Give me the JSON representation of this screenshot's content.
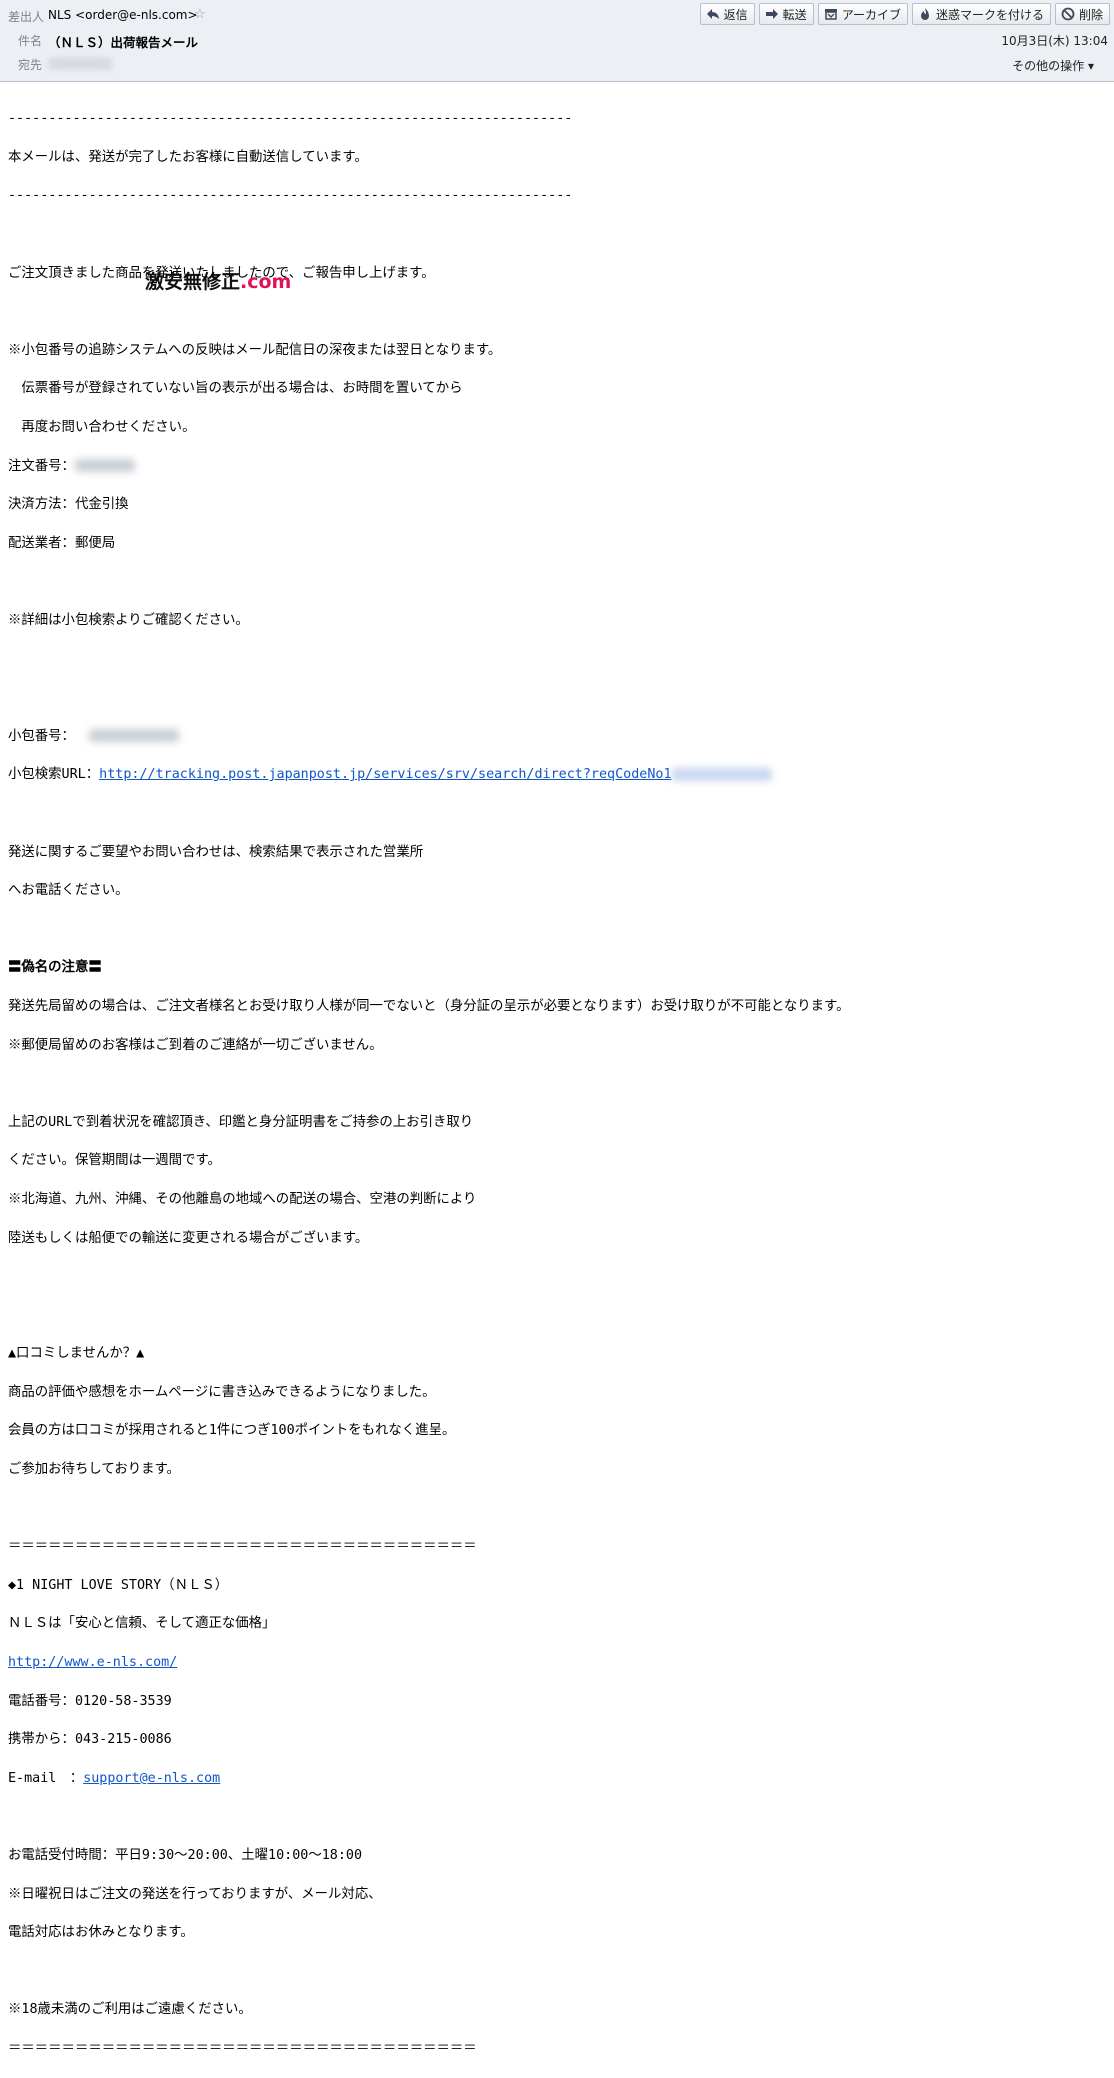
{
  "header": {
    "from_label": "差出人",
    "from_value": "NLS <order@e-nls.com>",
    "subject_label": "件名",
    "subject_value": "（ＮＬＳ）出荷報告メール",
    "to_label": "宛先",
    "date": "10月3日(木) 13:04",
    "more_actions": "その他の操作 ▾",
    "toolbar": {
      "reply": "返信",
      "forward": "転送",
      "archive": "アーカイブ",
      "junk": "迷惑マークを付ける",
      "delete": "削除"
    }
  },
  "watermark": {
    "main": "激安無修正",
    "suffix": ".com"
  },
  "body": {
    "rule_dash": "----------------------------------------------------------------------",
    "notice": "本メールは、発送が完了したお客様に自動送信しています。",
    "intro": "ご注文頂きました商品を発送いたしましたので、ご報告申し上げます。",
    "note1": "※小包番号の追跡システムへの反映はメール配信日の深夜または翌日となります。",
    "note2": "　伝票番号が登録されていない旨の表示が出る場合は、お時間を置いてから",
    "note3": "　再度お問い合わせください。",
    "order_no_label": "注文番号：",
    "payment": "決済方法：代金引換",
    "carrier": "配送業者：郵便局",
    "detail_note": "※詳細は小包検索よりご確認ください。",
    "parcel_no_label": "小包番号：",
    "tracking_label": "小包検索URL：",
    "tracking_url": "http://tracking.post.japanpost.jp/services/srv/search/direct?reqCodeNo1",
    "contact1": "発送に関するご要望やお問い合わせは、検索結果で表示された営業所",
    "contact2": "へお電話ください。",
    "alias_heading": "〓偽名の注意〓",
    "alias1": "発送先局留めの場合は、ご注文者様名とお受け取り人様が同一でないと（身分証の呈示が必要となります）お受け取りが不可能となります。",
    "alias2": "※郵便局留めのお客様はご到着のご連絡が一切ございません。",
    "pickup1": "上記のURLで到着状況を確認頂き、印鑑と身分証明書をご持参の上お引き取り",
    "pickup2": "ください。保管期間は一週間です。",
    "pickup3": "※北海道、九州、沖縄、その他離島の地域への配送の場合、空港の判断により",
    "pickup4": "陸送もしくは船便での輸送に変更される場合がございます。",
    "review_heading": "▲口コミしませんか？▲",
    "review1": "商品の評価や感想をホームページに書き込みできるようになりました。",
    "review2": "会員の方は口コミが採用されると1件につぎ100ポイントをもれなく進呈。",
    "review3": "ご参加お待ちしております。",
    "rule_eq": "＝＝＝＝＝＝＝＝＝＝＝＝＝＝＝＝＝＝＝＝＝＝＝＝＝＝＝＝＝＝＝＝＝＝＝",
    "shop_name": "◆1 NIGHT LOVE STORY（ＮＬＳ）",
    "shop_tagline": "ＮＬＳは「安心と信頼、そして適正な価格」",
    "shop_url": "http://www.e-nls.com/",
    "phone": "電話番号：0120-58-3539",
    "mobile": "携帯から：043-215-0086",
    "email_label": "E-mail　：",
    "email": "support@e-nls.com",
    "hours": "お電話受付時間：平日9:30～20:00、土曜10:00～18:00",
    "hours_note1": "※日曜祝日はご注文の発送を行っておりますが、メール対応、",
    "hours_note2": "電話対応はお休みとなります。",
    "age_note": "※18歳未満のご利用はご遠慮ください。"
  }
}
